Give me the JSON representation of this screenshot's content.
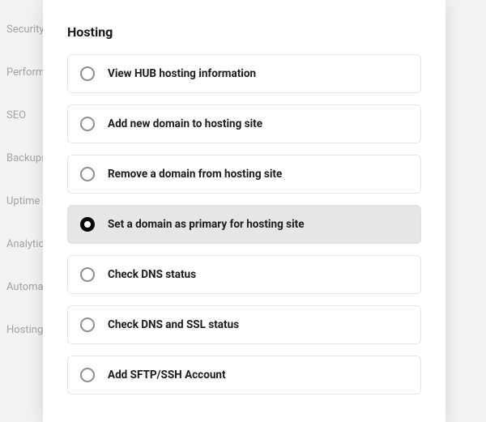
{
  "sidebar": {
    "items": [
      {
        "label": "Security"
      },
      {
        "label": "Performance"
      },
      {
        "label": "SEO"
      },
      {
        "label": "Backups"
      },
      {
        "label": "Uptime"
      },
      {
        "label": "Analytics"
      },
      {
        "label": "Automate"
      },
      {
        "label": "Hosting"
      }
    ]
  },
  "modal": {
    "title": "Hosting",
    "options": [
      {
        "label": "View HUB hosting information",
        "selected": false
      },
      {
        "label": "Add new domain to hosting site",
        "selected": false
      },
      {
        "label": "Remove a domain from hosting site",
        "selected": false
      },
      {
        "label": "Set a domain as primary for hosting site",
        "selected": true
      },
      {
        "label": "Check DNS status",
        "selected": false
      },
      {
        "label": "Check DNS and SSL status",
        "selected": false
      },
      {
        "label": "Add SFTP/SSH Account",
        "selected": false
      }
    ]
  }
}
